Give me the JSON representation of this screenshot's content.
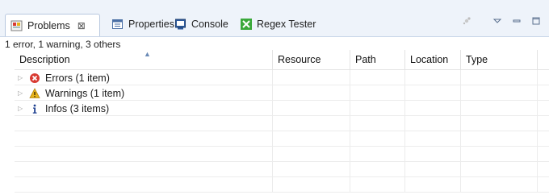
{
  "tabs": [
    {
      "label": "Problems",
      "icon": "problems-icon",
      "active": true,
      "close": "⊠"
    },
    {
      "label": "Properties",
      "icon": "properties-icon"
    },
    {
      "label": "Console",
      "icon": "console-icon"
    },
    {
      "label": "Regex Tester",
      "icon": "regex-tester-icon"
    }
  ],
  "view_tools": [
    "view-menu-icon",
    "minimize-icon",
    "maximize-icon"
  ],
  "summary": "1 error, 1 warning, 3 others",
  "columns": [
    "Description",
    "Resource",
    "Path",
    "Location",
    "Type"
  ],
  "rows": [
    {
      "label": "Errors (1 item)",
      "icon": "error-icon"
    },
    {
      "label": "Warnings (1 item)",
      "icon": "warning-icon"
    },
    {
      "label": "Infos (3 items)",
      "icon": "info-icon"
    }
  ],
  "colors": {
    "error": "#d83a32",
    "warning": "#e6b31b",
    "info": "#1d3f8f",
    "tab_bg": "#eef3fa"
  }
}
